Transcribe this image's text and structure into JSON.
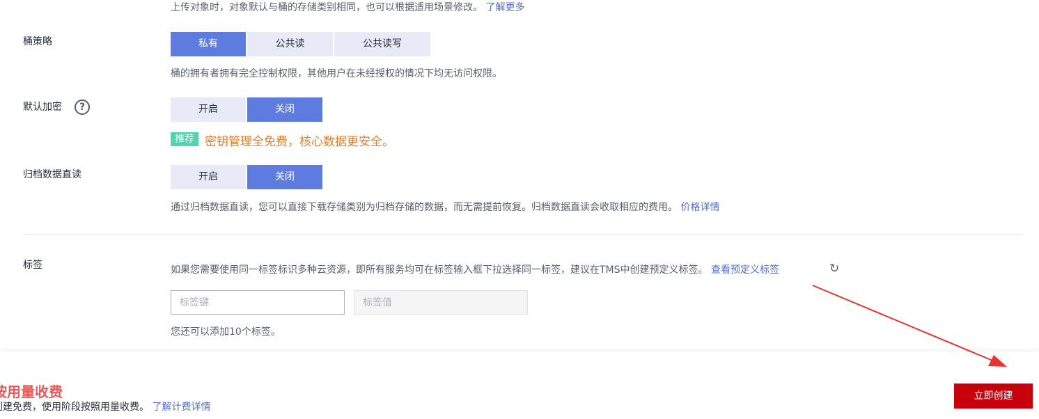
{
  "top_hint": {
    "text": "上传对象时，对象默认与桶的存储类别相同，也可以根据适用场景修改。",
    "link": "了解更多"
  },
  "bucket_policy": {
    "label": "桶策略",
    "options": [
      "私有",
      "公共读",
      "公共读写"
    ],
    "selected": "私有",
    "hint": "桶的拥有者拥有完全控制权限，其他用户在未经授权的情况下均无访问权限。"
  },
  "default_encryption": {
    "label": "默认加密",
    "help_icon": "?",
    "options": [
      "开启",
      "关闭"
    ],
    "selected": "关闭",
    "badge": "推荐",
    "promo": "密钥管理全免费，核心数据更安全。"
  },
  "archive_direct_read": {
    "label": "归档数据直读",
    "options": [
      "开启",
      "关闭"
    ],
    "selected": "关闭",
    "hint": "通过归档数据直读，您可以直接下载存储类别为归档存储的数据，而无需提前恢复。归档数据直读会收取相应的费用。",
    "link": "价格详情"
  },
  "tags": {
    "label": "标签",
    "hint": "如果您需要使用同一标签标识多种云资源，即所有服务均可在标签输入框下拉选择同一标签，建议在TMS中创建预定义标签。",
    "link": "查看预定义标签",
    "refresh_icon": "↻",
    "key_placeholder": "标签键",
    "value_placeholder": "标签值",
    "remaining": "您还可以添加10个标签。"
  },
  "footer": {
    "price_title": "按用量收费",
    "price_hint": "创建免费，使用阶段按照用量收费。",
    "price_link": "了解计费详情",
    "create_button": "立即创建"
  },
  "annotation": {
    "arrow_color": "#e8342e"
  },
  "colors": {
    "accent": "#5e7ce0",
    "primary_button": "#c7000b",
    "link": "#526ecc"
  }
}
